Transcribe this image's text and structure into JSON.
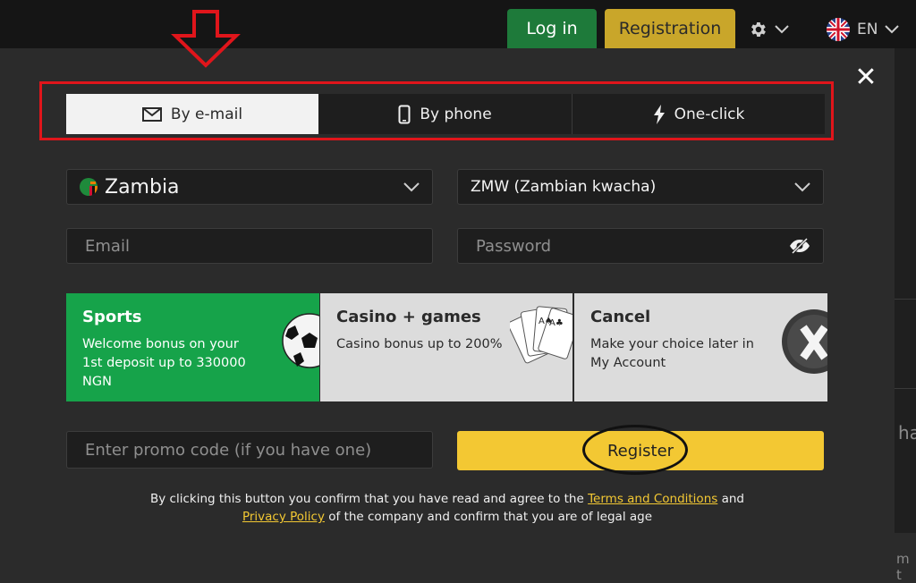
{
  "header": {
    "login_label": "Log in",
    "registration_label": "Registration",
    "language_label": "EN"
  },
  "modal": {
    "close_symbol": "✕",
    "tabs": [
      {
        "label": "By e-mail",
        "icon": "envelope-icon",
        "active": true
      },
      {
        "label": "By phone",
        "icon": "phone-icon",
        "active": false
      },
      {
        "label": "One-click",
        "icon": "lightning-icon",
        "active": false
      }
    ],
    "country": {
      "value": "Zambia",
      "flag": "zambia-flag"
    },
    "currency": {
      "value": "ZMW (Zambian kwacha)"
    },
    "email": {
      "placeholder": "Email"
    },
    "password": {
      "placeholder": "Password"
    },
    "bonus_cards": [
      {
        "title": "Sports",
        "text": "Welcome bonus on your 1st deposit up to 330000 NGN",
        "icon": "soccer-ball-icon"
      },
      {
        "title": "Casino + games",
        "text": "Casino bonus up to 200%",
        "icon": "playing-cards-icon"
      },
      {
        "title": "Cancel",
        "text": "Make your choice later in My Account",
        "icon": "cancel-x-icon"
      }
    ],
    "promo": {
      "placeholder": "Enter promo code (if you have one)"
    },
    "register_label": "Register",
    "terms": {
      "before": "By clicking this button you confirm that you have read and agree to the ",
      "terms_link": "Terms and Conditions",
      "and": " and",
      "privacy_link": "Privacy Policy",
      "after": " of the company and confirm that you are of legal age"
    }
  },
  "background_fragments": {
    "line1": "ha",
    "line2": "m t"
  },
  "colors": {
    "login_green": "#1e7a3a",
    "registration_gold": "#c9a62a",
    "register_yellow": "#f3c833",
    "sports_green": "#16a34a",
    "annotation_red": "#e0151b"
  }
}
